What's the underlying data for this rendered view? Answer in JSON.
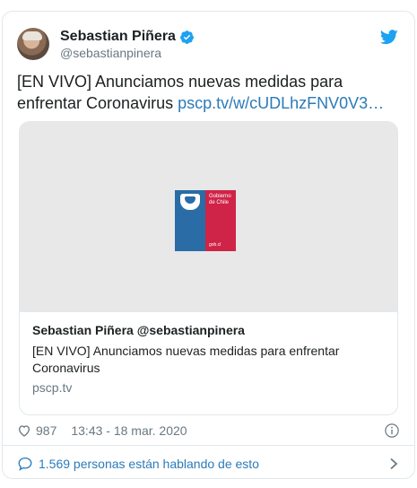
{
  "author": {
    "name": "Sebastian Piñera",
    "handle": "@sebastianpinera"
  },
  "tweet": {
    "text": "[EN VIVO] Anunciamos nuevas medidas para enfrentar Coronavirus ",
    "link": "pscp.tv/w/cUDLhzFNV0V3…"
  },
  "card": {
    "logo_text": "Gobierno de Chile",
    "logo_domain": "gob.cl",
    "title": "Sebastian Piñera @sebastianpinera",
    "description": "[EN VIVO] Anunciamos nuevas medidas para enfrentar Coronavirus",
    "domain": "pscp.tv"
  },
  "meta": {
    "likes": "987",
    "timestamp": "13:43 - 18 mar. 2020"
  },
  "footer": {
    "conversation": "1.569 personas están hablando de esto"
  },
  "colors": {
    "link": "#2b7bb9",
    "verified": "#1da1f2",
    "secondary_text": "#697882",
    "logo_blue": "#2a6ca5",
    "logo_red": "#cf2347"
  },
  "icons": [
    "verified-icon",
    "twitter-bird-icon",
    "heart-icon",
    "info-icon",
    "speech-bubble-icon",
    "chevron-right-icon"
  ]
}
